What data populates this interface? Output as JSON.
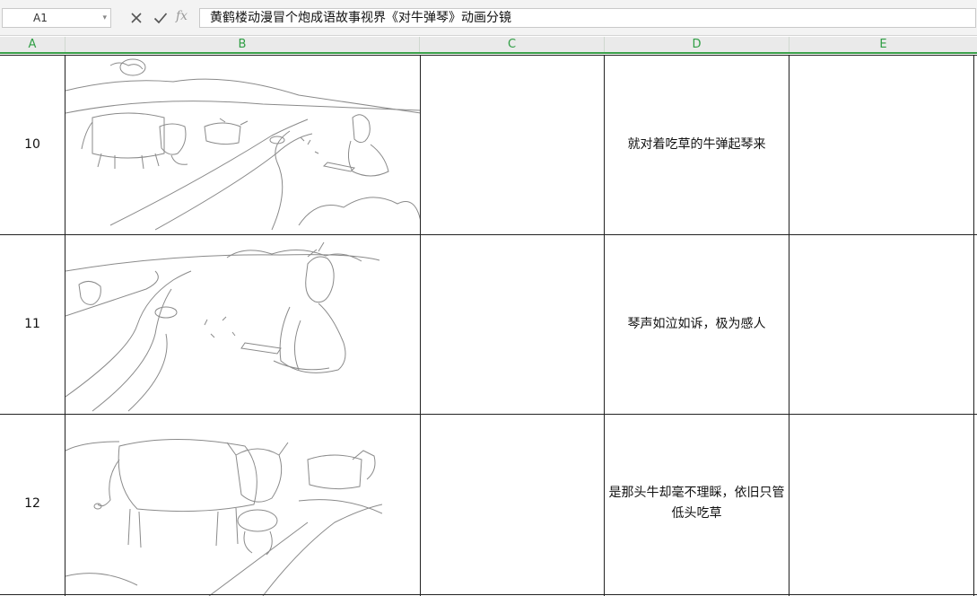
{
  "formula_bar": {
    "name_box": "A1",
    "fx": "fx",
    "content": "黄鹤楼动漫冒个炮成语故事视界《对牛弹琴》动画分镜"
  },
  "columns": [
    "A",
    "B",
    "C",
    "D",
    "E"
  ],
  "rows": [
    {
      "num": "10",
      "desc": "就对着吃草的牛弹起琴来"
    },
    {
      "num": "11",
      "desc": "琴声如泣如诉，极为感人"
    },
    {
      "num": "12",
      "desc": "是那头牛却毫不理睬，依旧只管低头吃草"
    }
  ],
  "images": [
    {
      "icon": "storyboard-cows-and-musician-sketch"
    },
    {
      "icon": "storyboard-musician-playing-sketch"
    },
    {
      "icon": "storyboard-cow-grazing-sketch"
    }
  ]
}
